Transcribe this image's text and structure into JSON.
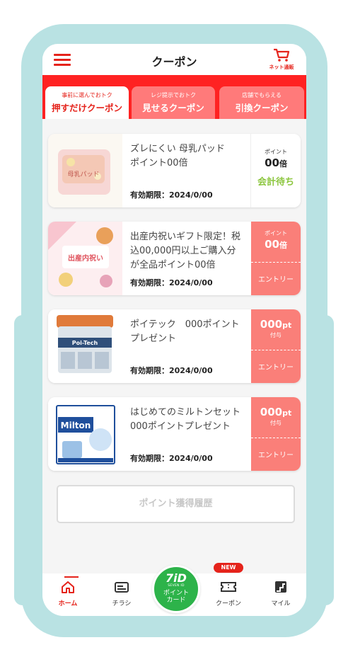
{
  "header": {
    "title": "クーポン",
    "cart_label": "ネット通販"
  },
  "tabs": [
    {
      "small": "事前に選んでおトク",
      "big": "押すだけクーポン",
      "active": true
    },
    {
      "small": "レジ提示でおトク",
      "big": "見せるクーポン",
      "active": false
    },
    {
      "small": "店舗でもらえる",
      "big": "引換クーポン",
      "active": false
    }
  ],
  "coupons": [
    {
      "name": "ズレにくい 母乳パッド\nポイント00倍",
      "expiry": "有効期限：2024/0/00",
      "side_label": "ポイント",
      "side_points": "00",
      "side_unit": "倍",
      "status": "会計待ち",
      "thumb_text": "母乳パッド"
    },
    {
      "name": "出産内祝いギフト限定！税込00,000円以上ご購入分が全品ポイント00倍",
      "expiry": "有効期限：2024/0/00",
      "side_label": "ポイント",
      "side_points": "00",
      "side_unit": "倍",
      "entry": "エントリー",
      "thumb_text": "出産内祝い"
    },
    {
      "name": "ポイテック　000ポイントプレゼント",
      "expiry": "有効期限：2024/0/00",
      "side_points": "000",
      "side_unit": "pt",
      "side_sub": "付与",
      "entry": "エントリー",
      "thumb_text": "Poi-Tech"
    },
    {
      "name": "はじめてのミルトンセット 000ポイントプレゼント",
      "expiry": "有効期限：2024/0/00",
      "side_points": "000",
      "side_unit": "pt",
      "side_sub": "付与",
      "entry": "エントリー",
      "thumb_text": "Milton"
    }
  ],
  "history_button": "ポイント獲得履歴",
  "nav": {
    "home": "ホーム",
    "flyer": "チラシ",
    "card_logo": "7iD",
    "card_sub": "SEVEN ID",
    "card_line1": "ポイント",
    "card_line2": "カード",
    "coupon": "クーポン",
    "new_badge": "NEW",
    "mile": "マイル"
  },
  "colors": {
    "brand_red": "#e5231b",
    "coral": "#fa7f79",
    "wait_green": "#8cc63e",
    "card_green": "#2db34a",
    "frame": "#b9e2e3"
  }
}
